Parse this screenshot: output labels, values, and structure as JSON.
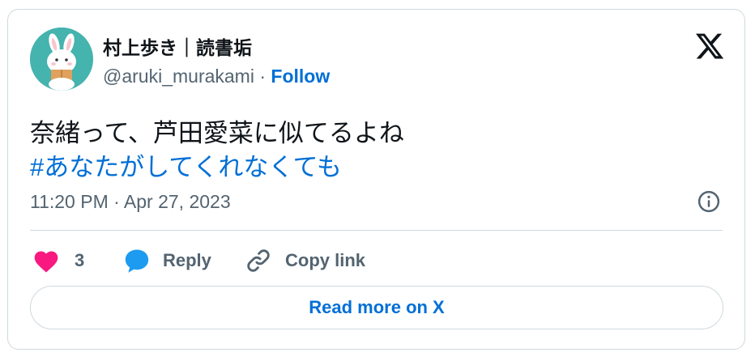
{
  "author": {
    "display_name": "村上歩き｜読書垢",
    "handle": "@aruki_murakami",
    "separator": " · ",
    "follow_label": "Follow"
  },
  "tweet": {
    "text": "奈緒って、芦田愛菜に似てるよね",
    "hashtag": "#あなたがしてくれなくても",
    "timestamp": "11:20 PM · Apr 27, 2023"
  },
  "actions": {
    "like_count": "3",
    "reply_label": "Reply",
    "copy_link_label": "Copy link"
  },
  "footer": {
    "read_more_label": "Read more on X"
  },
  "icons": {
    "like": "heart-icon",
    "reply": "speech-bubble-icon",
    "copy_link": "link-icon",
    "info": "info-icon",
    "logo": "x-logo-icon"
  },
  "colors": {
    "like": "#f91880",
    "reply": "#1d9bf0",
    "link": "#006fd6",
    "secondary_text": "#536471",
    "avatar_bg": "#45b3ae"
  }
}
